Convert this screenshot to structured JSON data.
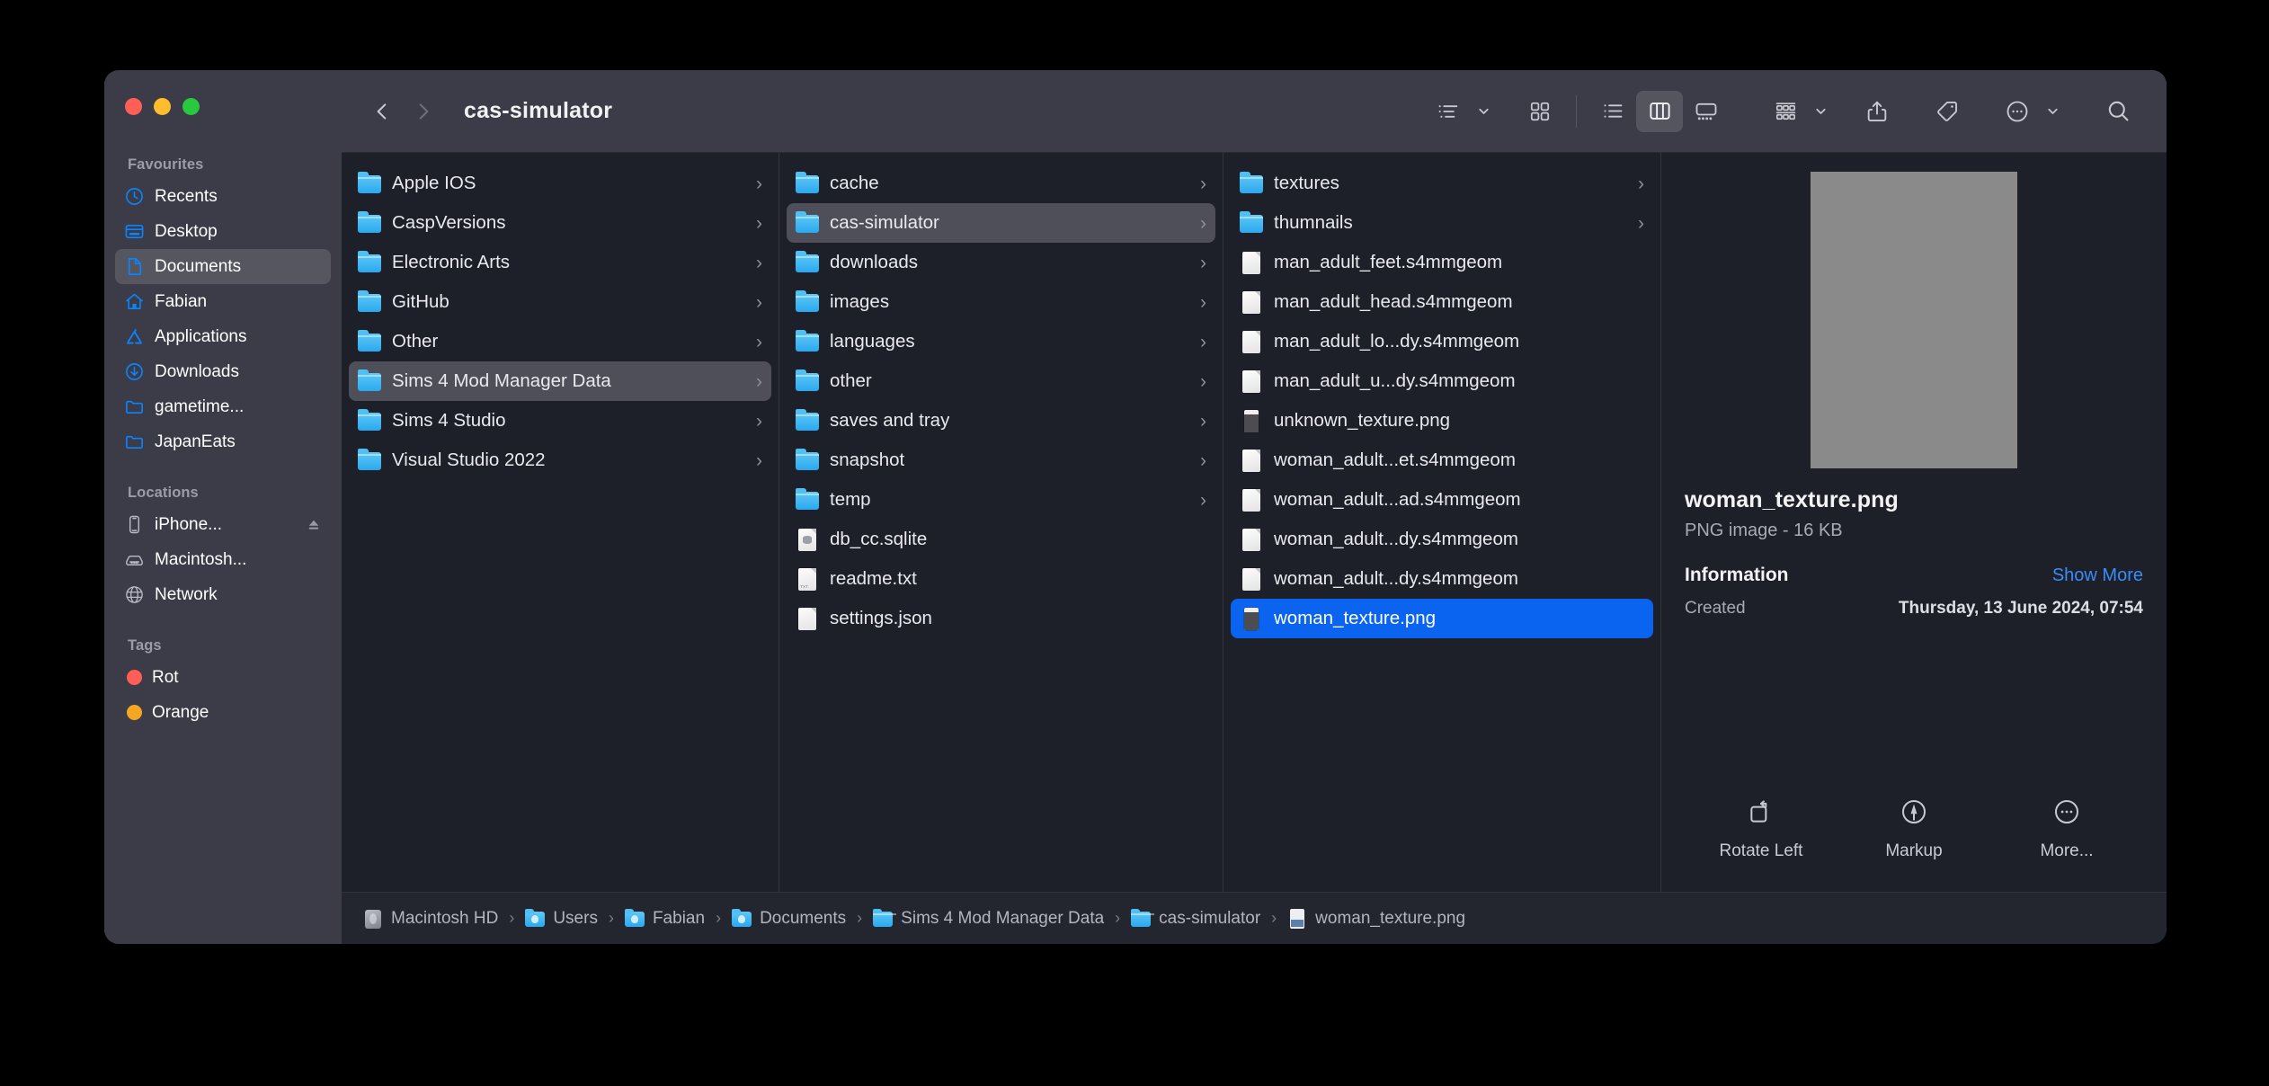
{
  "window": {
    "title": "cas-simulator",
    "traffic_lights": [
      "close",
      "minimize",
      "zoom"
    ]
  },
  "toolbar": {
    "back_label": "Back",
    "forward_label": "Forward",
    "group_by_label": "Group By",
    "icon_view_label": "Icon View",
    "list_view_label": "List View",
    "column_view_label": "Column View",
    "gallery_view_label": "Gallery View",
    "arrange_label": "Arrange",
    "share_label": "Share",
    "tags_label": "Tags",
    "more_label": "More",
    "search_label": "Search"
  },
  "sidebar": {
    "sections": [
      {
        "title": "Favourites",
        "items": [
          {
            "label": "Recents",
            "icon": "clock-icon",
            "selected": false
          },
          {
            "label": "Desktop",
            "icon": "desktop-icon",
            "selected": false
          },
          {
            "label": "Documents",
            "icon": "document-icon",
            "selected": true
          },
          {
            "label": "Fabian",
            "icon": "home-icon",
            "selected": false
          },
          {
            "label": "Applications",
            "icon": "applications-icon",
            "selected": false
          },
          {
            "label": "Downloads",
            "icon": "downloads-icon",
            "selected": false
          },
          {
            "label": "gametime...",
            "icon": "folder-icon",
            "selected": false
          },
          {
            "label": "JapanEats",
            "icon": "folder-icon",
            "selected": false
          }
        ]
      },
      {
        "title": "Locations",
        "items": [
          {
            "label": "iPhone...",
            "icon": "iphone-icon",
            "selected": false,
            "eject": true
          },
          {
            "label": "Macintosh...",
            "icon": "harddisk-icon",
            "selected": false
          },
          {
            "label": "Network",
            "icon": "globe-icon",
            "selected": false
          }
        ]
      },
      {
        "title": "Tags",
        "items": [
          {
            "label": "Rot",
            "icon": "tag-dot",
            "color": "#ff5f57",
            "selected": false
          },
          {
            "label": "Orange",
            "icon": "tag-dot",
            "color": "#f5a623",
            "selected": false
          }
        ]
      }
    ]
  },
  "columns": [
    {
      "name": "column-1",
      "rows": [
        {
          "label": "Apple IOS",
          "kind": "folder",
          "disclosure": true,
          "state": "none"
        },
        {
          "label": "CaspVersions",
          "kind": "folder",
          "disclosure": true,
          "state": "none"
        },
        {
          "label": "Electronic Arts",
          "kind": "folder",
          "disclosure": true,
          "state": "none"
        },
        {
          "label": "GitHub",
          "kind": "folder",
          "disclosure": true,
          "state": "none"
        },
        {
          "label": "Other",
          "kind": "folder",
          "disclosure": true,
          "state": "none"
        },
        {
          "label": "Sims 4 Mod Manager Data",
          "kind": "folder",
          "disclosure": true,
          "state": "gray"
        },
        {
          "label": "Sims 4 Studio",
          "kind": "folder",
          "disclosure": true,
          "state": "none"
        },
        {
          "label": "Visual Studio 2022",
          "kind": "folder",
          "disclosure": true,
          "state": "none"
        }
      ]
    },
    {
      "name": "column-2",
      "rows": [
        {
          "label": "cache",
          "kind": "folder",
          "disclosure": true,
          "state": "none"
        },
        {
          "label": "cas-simulator",
          "kind": "folder",
          "disclosure": true,
          "state": "gray"
        },
        {
          "label": "downloads",
          "kind": "folder",
          "disclosure": true,
          "state": "none"
        },
        {
          "label": "images",
          "kind": "folder",
          "disclosure": true,
          "state": "none"
        },
        {
          "label": "languages",
          "kind": "folder",
          "disclosure": true,
          "state": "none"
        },
        {
          "label": "other",
          "kind": "folder",
          "disclosure": true,
          "state": "none"
        },
        {
          "label": "saves and tray",
          "kind": "folder",
          "disclosure": true,
          "state": "none"
        },
        {
          "label": "snapshot",
          "kind": "folder",
          "disclosure": true,
          "state": "none"
        },
        {
          "label": "temp",
          "kind": "folder",
          "disclosure": true,
          "state": "none"
        },
        {
          "label": "db_cc.sqlite",
          "kind": "db",
          "disclosure": false,
          "state": "none"
        },
        {
          "label": "readme.txt",
          "kind": "txt",
          "disclosure": false,
          "state": "none"
        },
        {
          "label": "settings.json",
          "kind": "doc",
          "disclosure": false,
          "state": "none"
        }
      ]
    },
    {
      "name": "column-3",
      "rows": [
        {
          "label": "textures",
          "kind": "folder",
          "disclosure": true,
          "state": "none"
        },
        {
          "label": "thumnails",
          "kind": "folder",
          "disclosure": true,
          "state": "none"
        },
        {
          "label": "man_adult_feet.s4mmgeom",
          "kind": "doc",
          "disclosure": false,
          "state": "none"
        },
        {
          "label": "man_adult_head.s4mmgeom",
          "kind": "doc",
          "disclosure": false,
          "state": "none"
        },
        {
          "label": "man_adult_lo...dy.s4mmgeom",
          "kind": "doc",
          "disclosure": false,
          "state": "none"
        },
        {
          "label": "man_adult_u...dy.s4mmgeom",
          "kind": "doc",
          "disclosure": false,
          "state": "none"
        },
        {
          "label": "unknown_texture.png",
          "kind": "png",
          "disclosure": false,
          "state": "none"
        },
        {
          "label": "woman_adult...et.s4mmgeom",
          "kind": "doc",
          "disclosure": false,
          "state": "none"
        },
        {
          "label": "woman_adult...ad.s4mmgeom",
          "kind": "doc",
          "disclosure": false,
          "state": "none"
        },
        {
          "label": "woman_adult...dy.s4mmgeom",
          "kind": "doc",
          "disclosure": false,
          "state": "none"
        },
        {
          "label": "woman_adult...dy.s4mmgeom",
          "kind": "doc",
          "disclosure": false,
          "state": "none"
        },
        {
          "label": "woman_texture.png",
          "kind": "png",
          "disclosure": false,
          "state": "blue"
        }
      ]
    }
  ],
  "preview": {
    "filename": "woman_texture.png",
    "subtitle": "PNG image - 16 KB",
    "information_label": "Information",
    "show_more_label": "Show More",
    "created_key": "Created",
    "created_value": "Thursday, 13 June 2024, 07:54",
    "actions": [
      {
        "label": "Rotate Left",
        "icon": "rotate-left-icon"
      },
      {
        "label": "Markup",
        "icon": "markup-icon"
      },
      {
        "label": "More...",
        "icon": "more-icon"
      }
    ]
  },
  "pathbar": {
    "crumbs": [
      {
        "label": "Macintosh HD",
        "icon": "harddisk-icon"
      },
      {
        "label": "Users",
        "icon": "users-folder-icon"
      },
      {
        "label": "Fabian",
        "icon": "home-folder-icon"
      },
      {
        "label": "Documents",
        "icon": "documents-folder-icon"
      },
      {
        "label": "Sims 4 Mod Manager Data",
        "icon": "folder-icon"
      },
      {
        "label": "cas-simulator",
        "icon": "folder-icon"
      },
      {
        "label": "woman_texture.png",
        "icon": "png-file-icon"
      }
    ],
    "separator": "›"
  },
  "colors": {
    "accent_blue": "#0a64f0",
    "sidebar_bg": "#3b3c47",
    "content_bg": "#1d2029",
    "link_blue": "#3b8cf8"
  }
}
